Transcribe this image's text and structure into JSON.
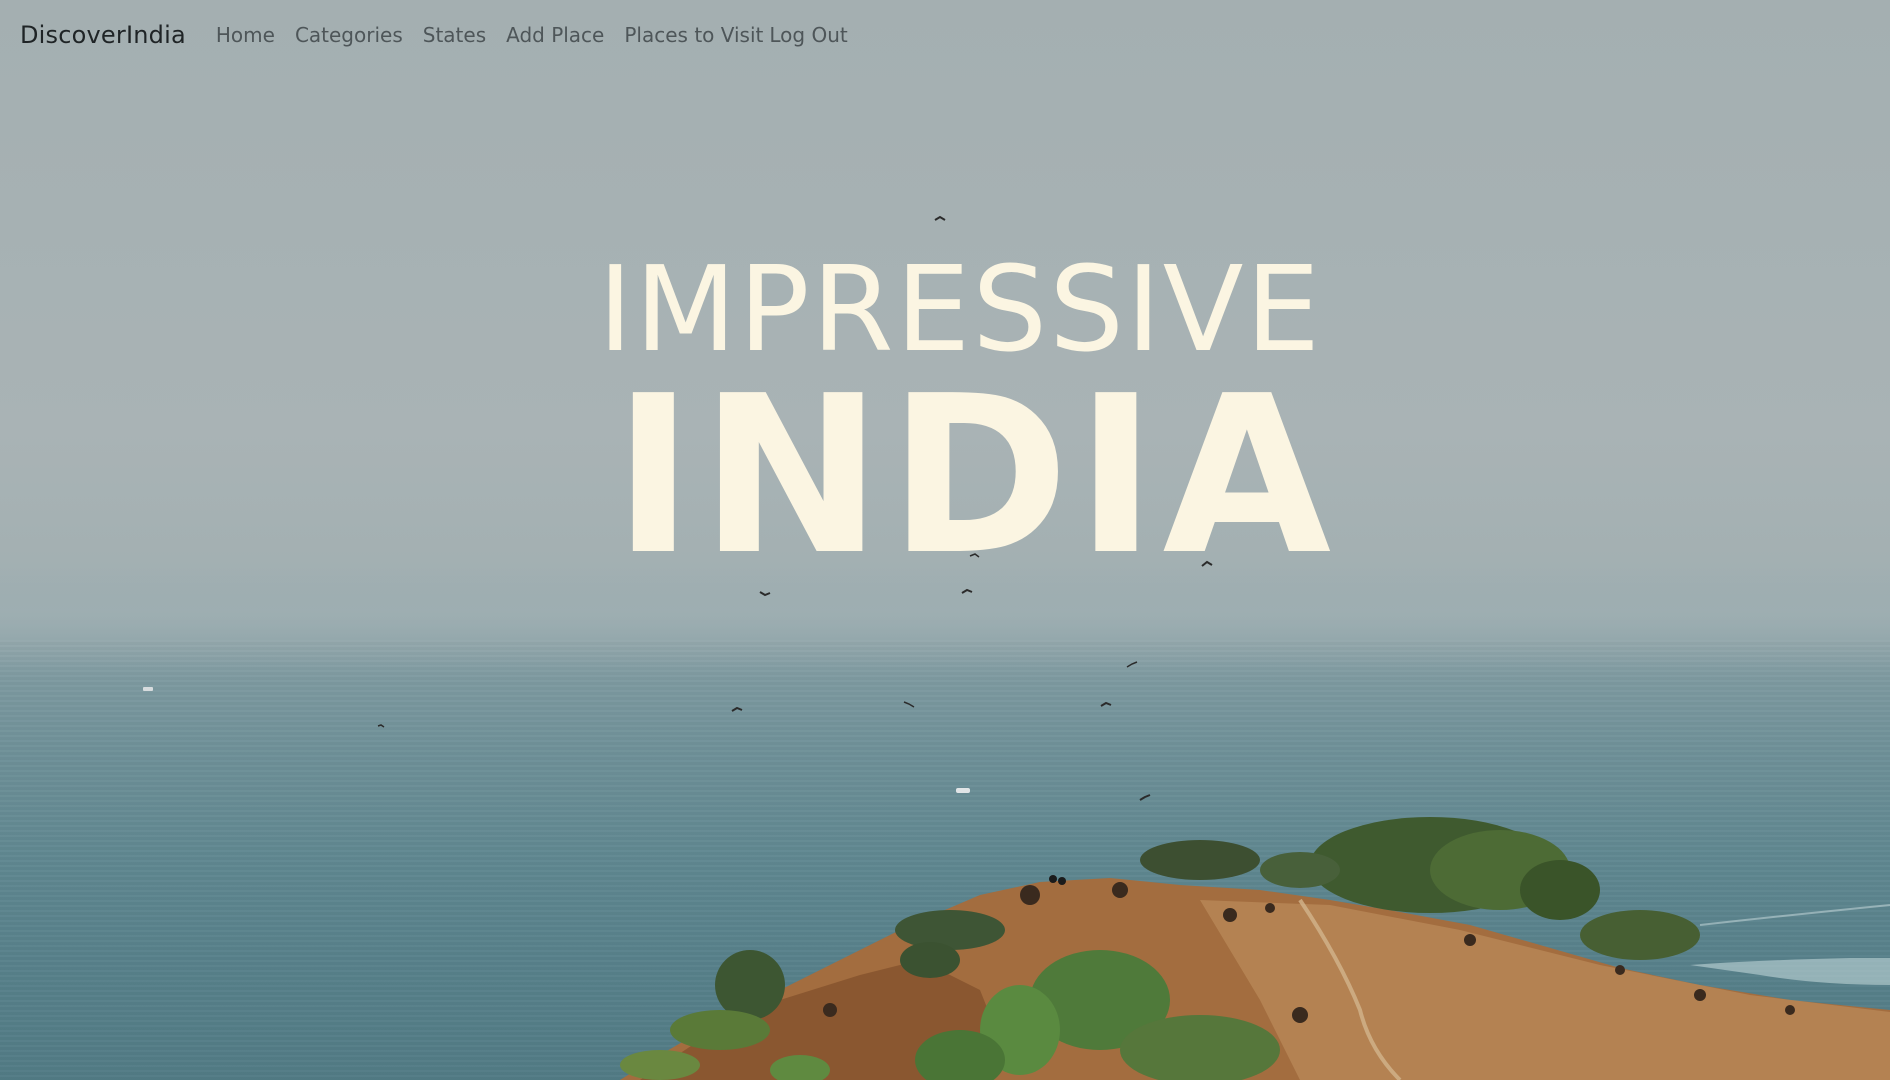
{
  "navbar": {
    "brand": "DiscoverIndia",
    "links": [
      {
        "label": "Home"
      },
      {
        "label": "Categories"
      },
      {
        "label": "States"
      },
      {
        "label": "Add Place"
      },
      {
        "label": "Places to Visit"
      },
      {
        "label": "Log Out"
      }
    ]
  },
  "hero": {
    "line1": "IMPRESSIVE",
    "line2": "INDIA"
  },
  "background": {
    "subject": "coastal-hill-over-sea-photo",
    "sky_color": "#a6b1b3",
    "sea_color": "#57808a",
    "hill_color": "#a06a3c",
    "hero_text_color": "#fbf5e2"
  }
}
